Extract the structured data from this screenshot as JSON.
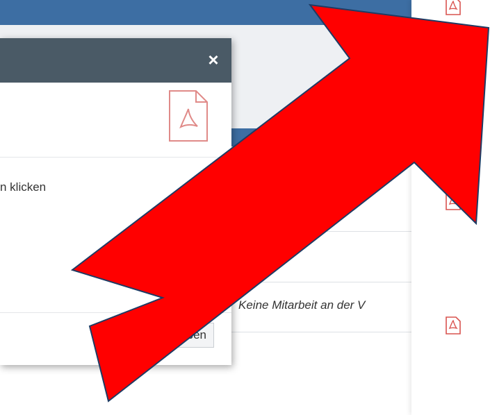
{
  "modal": {
    "close_label": "×",
    "instruction_text": "n klicken",
    "button_label": "ben"
  },
  "panel": {
    "row_text": "Keine Mitarbeit an der V"
  },
  "icons": {
    "pdf": "pdf-file-icon",
    "close": "close-icon"
  },
  "colors": {
    "topbar": "#3d6ea3",
    "modal_header": "#4a5a66",
    "pdf_red": "#d9534f",
    "arrow_fill": "#ff0000",
    "arrow_stroke": "#1f3b63"
  }
}
